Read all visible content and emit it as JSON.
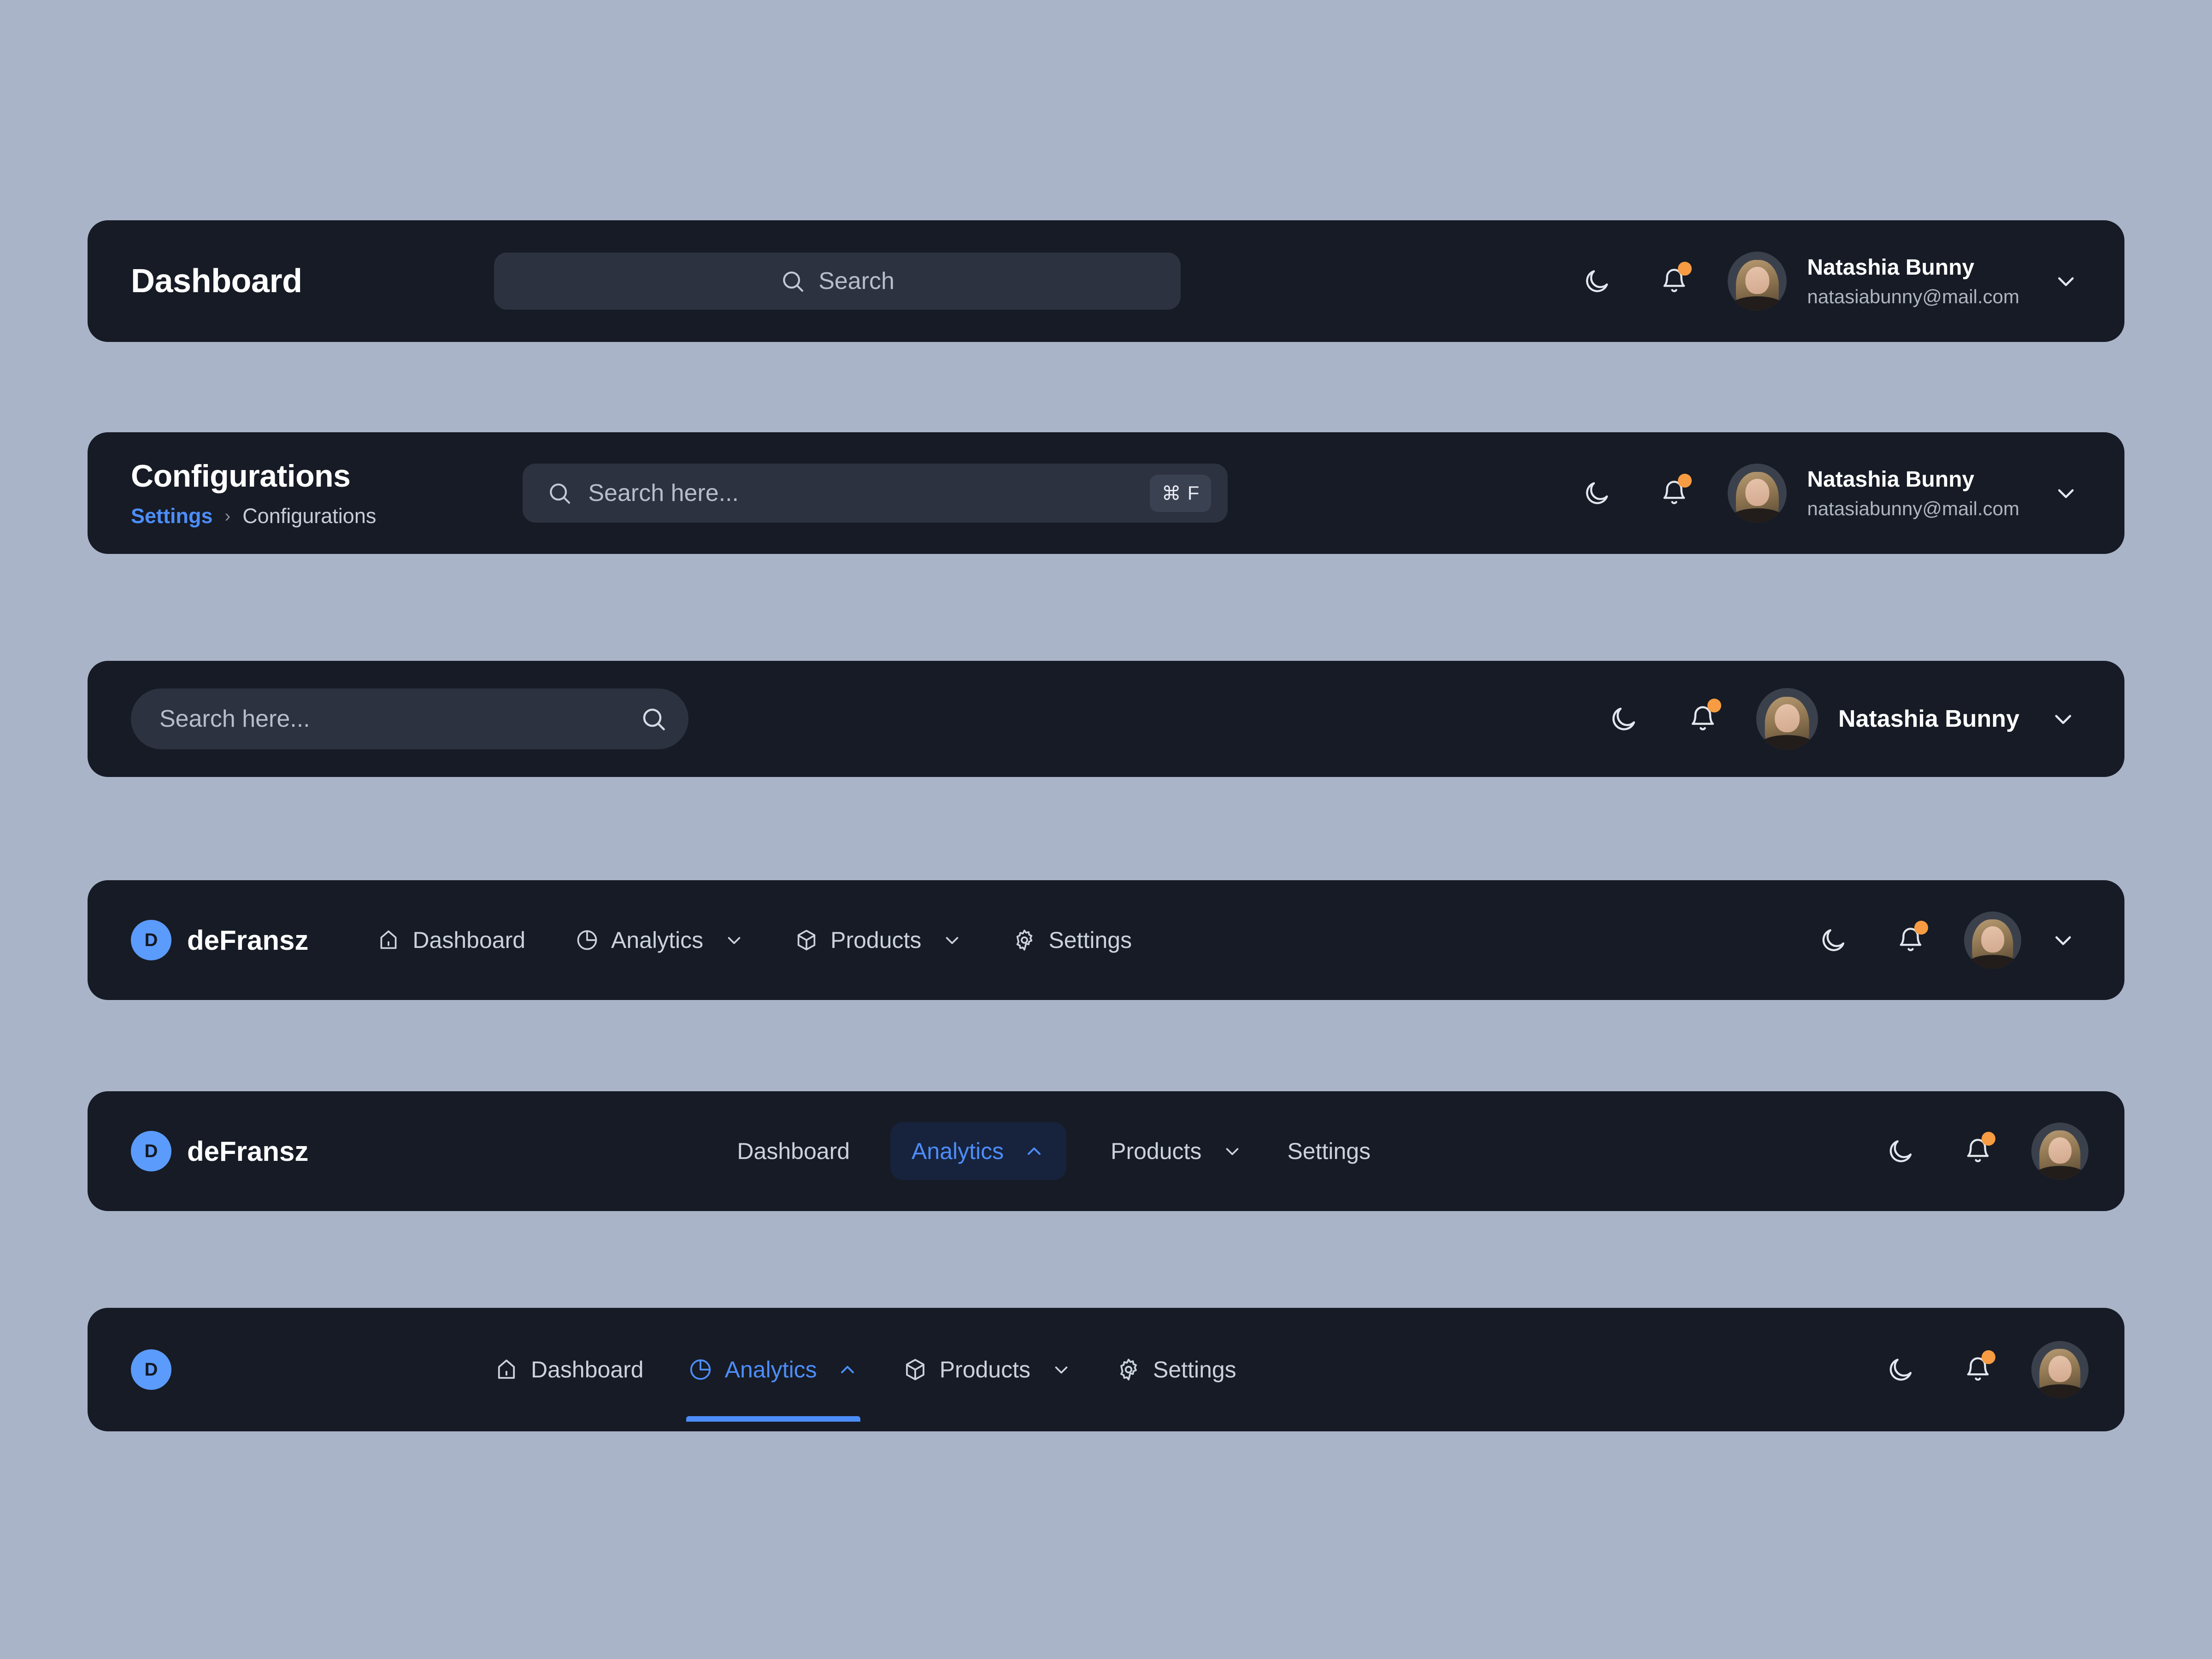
{
  "theme": {
    "page_bg": "#aab4c8",
    "navbar_bg": "#161b25",
    "field_bg": "#2c3240",
    "accent_blue": "#4d8df9",
    "brand_blue": "#5b9bfb",
    "active_pill_bg": "#17233d",
    "notification_dot": "#f79c42",
    "text_primary": "#ffffff",
    "text_muted": "#b7bdc9"
  },
  "user": {
    "name": "Natashia Bunny",
    "email": "natasiabunny@mail.com",
    "avatar_alt": "Natashia Bunny avatar"
  },
  "brand": {
    "mark": "D",
    "name": "deFransz"
  },
  "icons": {
    "search": "search-icon",
    "moon": "moon-icon",
    "bell": "bell-icon",
    "chevron_down": "chevron-down-icon",
    "chevron_up": "chevron-up-icon",
    "home": "home-icon",
    "pie": "pie-chart-icon",
    "cube": "cube-icon",
    "gear": "gear-icon",
    "breadcrumb_separator": "›"
  },
  "navbar_1": {
    "title": "Dashboard",
    "search": {
      "placeholder": "Search"
    }
  },
  "navbar_2": {
    "title": "Configurations",
    "breadcrumb": {
      "parent": "Settings",
      "separator": "›",
      "current": "Configurations"
    },
    "search": {
      "placeholder": "Search here...",
      "shortcut_modifier": "⌘",
      "shortcut_key": "F"
    }
  },
  "navbar_3": {
    "search": {
      "placeholder": "Search here..."
    }
  },
  "navbar_4": {
    "menu": [
      {
        "label": "Dashboard",
        "icon": "home-icon",
        "has_chevron": false,
        "active": false
      },
      {
        "label": "Analytics",
        "icon": "pie-chart-icon",
        "has_chevron": true,
        "active": false
      },
      {
        "label": "Products",
        "icon": "cube-icon",
        "has_chevron": true,
        "active": false
      },
      {
        "label": "Settings",
        "icon": "gear-icon",
        "has_chevron": false,
        "active": false
      }
    ]
  },
  "navbar_5": {
    "menu": [
      {
        "label": "Dashboard",
        "has_chevron": false,
        "active": false
      },
      {
        "label": "Analytics",
        "has_chevron": true,
        "active": true
      },
      {
        "label": "Products",
        "has_chevron": true,
        "active": false
      },
      {
        "label": "Settings",
        "has_chevron": false,
        "active": false
      }
    ]
  },
  "navbar_6": {
    "menu": [
      {
        "label": "Dashboard",
        "icon": "home-icon",
        "has_chevron": false,
        "active": false
      },
      {
        "label": "Analytics",
        "icon": "pie-chart-icon",
        "has_chevron": true,
        "active": true
      },
      {
        "label": "Products",
        "icon": "cube-icon",
        "has_chevron": true,
        "active": false
      },
      {
        "label": "Settings",
        "icon": "gear-icon",
        "has_chevron": false,
        "active": false
      }
    ]
  }
}
